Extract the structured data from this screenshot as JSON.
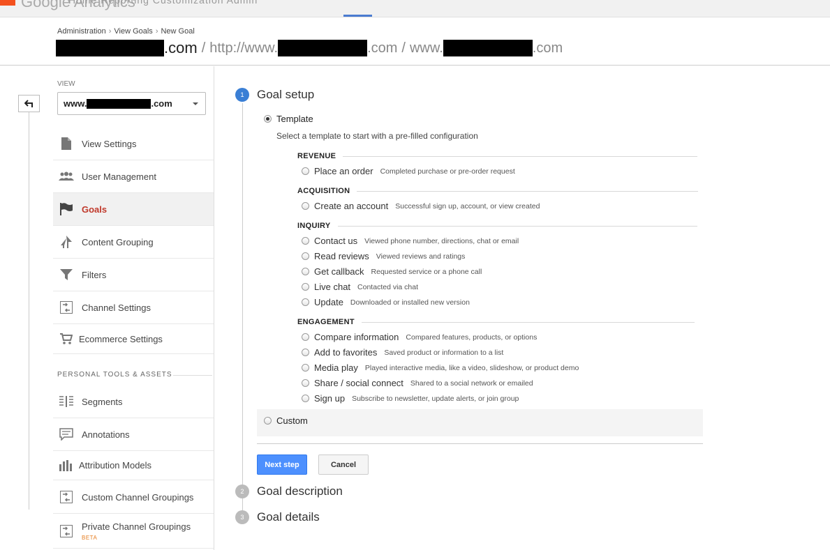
{
  "topbar": {
    "brand": "Google Analytics",
    "tabs": "Home   Reporting   Customization   Admin"
  },
  "breadcrumb": {
    "items": [
      "Administration",
      "View Goals",
      "New Goal"
    ],
    "separator": "›"
  },
  "account": {
    "domain_suffix": ".com",
    "slash": "/",
    "property_prefix": "http://www.",
    "property_suffix": ".com",
    "view_prefix": "www.",
    "view_suffix": ".com"
  },
  "sidebar": {
    "view_label": "VIEW",
    "view_prefix": "www.",
    "view_suffix": ".com",
    "items": [
      {
        "label": "View Settings",
        "icon": "document-icon"
      },
      {
        "label": "User Management",
        "icon": "users-icon"
      },
      {
        "label": "Goals",
        "icon": "flag-icon",
        "active": true
      },
      {
        "label": "Content Grouping",
        "icon": "content-grouping-icon"
      },
      {
        "label": "Filters",
        "icon": "filter-icon"
      },
      {
        "label": "Channel Settings",
        "icon": "channel-icon"
      },
      {
        "label": "Ecommerce Settings",
        "icon": "cart-icon"
      }
    ],
    "personal_label": "PERSONAL TOOLS & ASSETS",
    "personal_items": [
      {
        "label": "Segments",
        "icon": "segments-icon"
      },
      {
        "label": "Annotations",
        "icon": "annotation-icon"
      },
      {
        "label": "Attribution Models",
        "icon": "bar-chart-icon"
      },
      {
        "label": "Custom Channel Groupings",
        "icon": "channel-icon"
      },
      {
        "label": "Private Channel Groupings",
        "icon": "channel-icon",
        "badge": "BETA"
      }
    ]
  },
  "steps": [
    {
      "num": "1",
      "title": "Goal setup",
      "active": true
    },
    {
      "num": "2",
      "title": "Goal description"
    },
    {
      "num": "3",
      "title": "Goal details"
    }
  ],
  "goal_setup": {
    "template_label": "Template",
    "template_desc": "Select a template to start with a pre-filled configuration",
    "categories": [
      {
        "name": "REVENUE",
        "options": [
          {
            "name": "Place an order",
            "hint": "Completed purchase or pre-order request"
          }
        ]
      },
      {
        "name": "ACQUISITION",
        "options": [
          {
            "name": "Create an account",
            "hint": "Successful sign up, account, or view created"
          }
        ]
      },
      {
        "name": "INQUIRY",
        "options": [
          {
            "name": "Contact us",
            "hint": "Viewed phone number, directions, chat or email"
          },
          {
            "name": "Read reviews",
            "hint": "Viewed reviews and ratings"
          },
          {
            "name": "Get callback",
            "hint": "Requested service or a phone call"
          },
          {
            "name": "Live chat",
            "hint": "Contacted via chat"
          },
          {
            "name": "Update",
            "hint": "Downloaded or installed new version"
          }
        ]
      },
      {
        "name": "ENGAGEMENT",
        "options": [
          {
            "name": "Compare information",
            "hint": "Compared features, products, or options"
          },
          {
            "name": "Add to favorites",
            "hint": "Saved product or information to a list"
          },
          {
            "name": "Media play",
            "hint": "Played interactive media, like a video, slideshow, or product demo"
          },
          {
            "name": "Share / social connect",
            "hint": "Shared to a social network or emailed"
          },
          {
            "name": "Sign up",
            "hint": "Subscribe to newsletter, update alerts, or join group"
          }
        ]
      }
    ],
    "custom_label": "Custom"
  },
  "buttons": {
    "next": "Next step",
    "cancel": "Cancel"
  },
  "colors": {
    "accent": "#4d90fe",
    "active_nav": "#c0392b",
    "step_active": "#3a7fd5"
  }
}
